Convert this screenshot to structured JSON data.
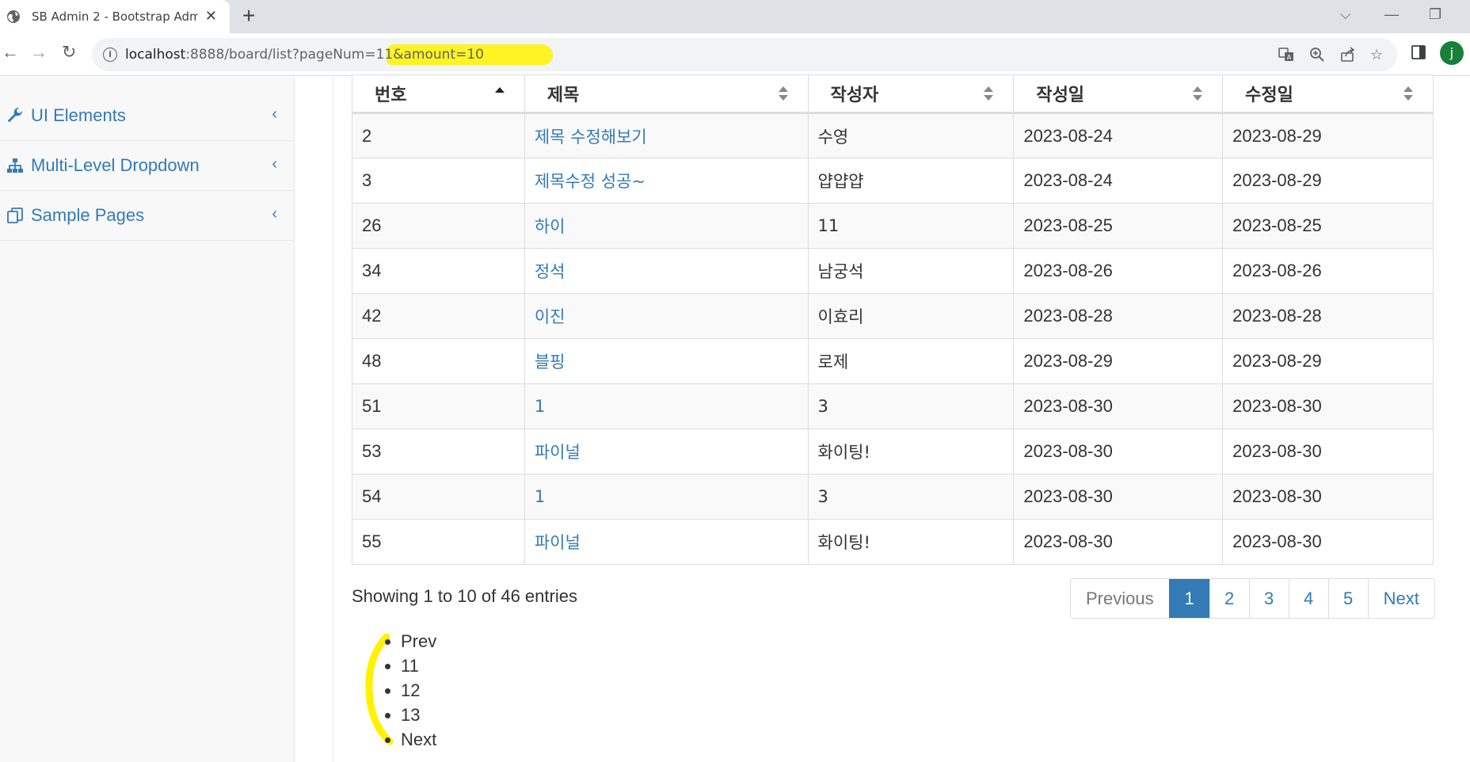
{
  "browser": {
    "tab_title": "SB Admin 2 - Bootstrap Admin",
    "url_host": "localhost",
    "url_path": ":8888/board/list?pageNum=11&amount=10",
    "avatar_letter": "j"
  },
  "sidebar": {
    "items": [
      {
        "label": "UI Elements",
        "icon": "wrench-icon"
      },
      {
        "label": "Multi-Level Dropdown",
        "icon": "sitemap-icon"
      },
      {
        "label": "Sample Pages",
        "icon": "files-icon"
      }
    ]
  },
  "table": {
    "headers": [
      "번호",
      "제목",
      "작성자",
      "작성일",
      "수정일"
    ],
    "rows": [
      {
        "num": "2",
        "title": "제목 수정해보기",
        "writer": "수영",
        "regdate": "2023-08-24",
        "updatedate": "2023-08-29"
      },
      {
        "num": "3",
        "title": "제목수정 성공~",
        "writer": "얍얍얍",
        "regdate": "2023-08-24",
        "updatedate": "2023-08-29"
      },
      {
        "num": "26",
        "title": "하이",
        "writer": "11",
        "regdate": "2023-08-25",
        "updatedate": "2023-08-25"
      },
      {
        "num": "34",
        "title": "정석",
        "writer": "남궁석",
        "regdate": "2023-08-26",
        "updatedate": "2023-08-26"
      },
      {
        "num": "42",
        "title": "이진",
        "writer": "이효리",
        "regdate": "2023-08-28",
        "updatedate": "2023-08-28"
      },
      {
        "num": "48",
        "title": "블핑",
        "writer": "로제",
        "regdate": "2023-08-29",
        "updatedate": "2023-08-29"
      },
      {
        "num": "51",
        "title": "1",
        "writer": "3",
        "regdate": "2023-08-30",
        "updatedate": "2023-08-30"
      },
      {
        "num": "53",
        "title": "파이널",
        "writer": "화이팅!",
        "regdate": "2023-08-30",
        "updatedate": "2023-08-30"
      },
      {
        "num": "54",
        "title": "1",
        "writer": "3",
        "regdate": "2023-08-30",
        "updatedate": "2023-08-30"
      },
      {
        "num": "55",
        "title": "파이널",
        "writer": "화이팅!",
        "regdate": "2023-08-30",
        "updatedate": "2023-08-30"
      }
    ]
  },
  "info": "Showing 1 to 10 of 46 entries",
  "pagination": {
    "previous": "Previous",
    "pages": [
      "1",
      "2",
      "3",
      "4",
      "5"
    ],
    "next": "Next"
  },
  "custom_pager": [
    "Prev",
    "11",
    "12",
    "13",
    "Next"
  ],
  "colors": {
    "link": "#337ab7",
    "highlight": "#fff200",
    "active_page": "#337ab7"
  }
}
